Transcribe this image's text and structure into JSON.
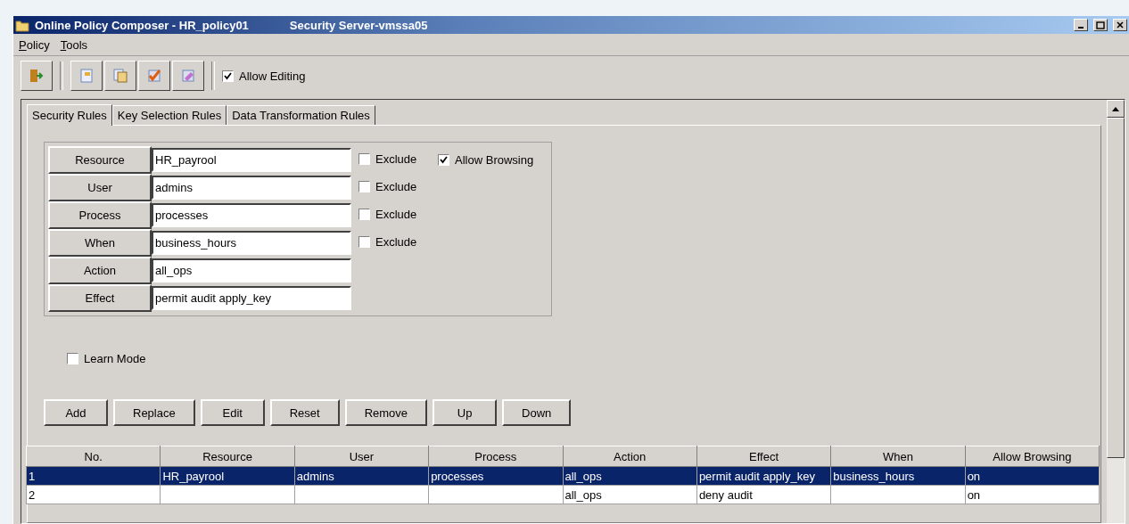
{
  "window": {
    "title": "Online Policy Composer - HR_policy01",
    "server": "Security Server-vmssa05"
  },
  "menu": [
    "Policy",
    "Tools"
  ],
  "toolbar": {
    "allow_editing": {
      "label": "Allow Editing",
      "checked": true
    }
  },
  "tabs": [
    {
      "label": "Security Rules",
      "selected": true
    },
    {
      "label": "Key Selection Rules",
      "selected": false
    },
    {
      "label": "Data Transformation Rules",
      "selected": false
    }
  ],
  "form": [
    {
      "label": "Resource",
      "value": "HR_payrool",
      "exclude": {
        "label": "Exclude",
        "checked": false
      },
      "allow_browsing": {
        "label": "Allow Browsing",
        "checked": true
      }
    },
    {
      "label": "User",
      "value": "admins",
      "exclude": {
        "label": "Exclude",
        "checked": false
      }
    },
    {
      "label": "Process",
      "value": "processes",
      "exclude": {
        "label": "Exclude",
        "checked": false
      }
    },
    {
      "label": "When",
      "value": "business_hours",
      "exclude": {
        "label": "Exclude",
        "checked": false
      }
    },
    {
      "label": "Action",
      "value": "all_ops"
    },
    {
      "label": "Effect",
      "value": "permit audit apply_key"
    }
  ],
  "learn_mode": {
    "label": "Learn Mode",
    "checked": false
  },
  "buttons": [
    "Add",
    "Replace",
    "Edit",
    "Reset",
    "Remove",
    "Up",
    "Down"
  ],
  "table": {
    "columns": [
      "No.",
      "Resource",
      "User",
      "Process",
      "Action",
      "Effect",
      "When",
      "Allow Browsing"
    ],
    "rows": [
      {
        "selected": true,
        "cells": [
          "1",
          "HR_payrool",
          "admins",
          "processes",
          "all_ops",
          "permit audit apply_key",
          "business_hours",
          "on"
        ]
      },
      {
        "selected": false,
        "cells": [
          "2",
          "",
          "",
          "",
          "all_ops",
          "deny audit",
          "",
          "on"
        ]
      }
    ]
  }
}
